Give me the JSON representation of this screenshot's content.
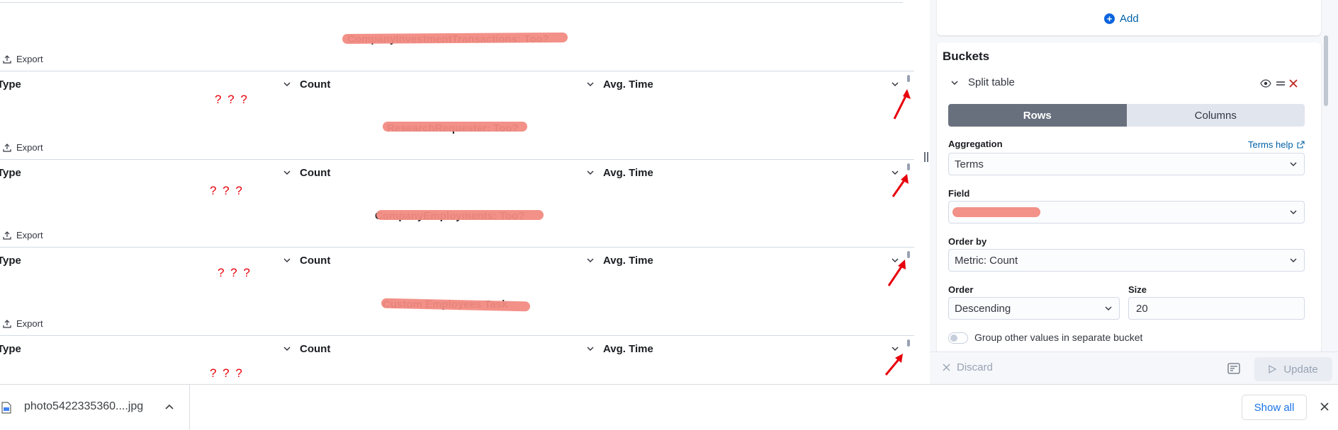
{
  "viz": {
    "tables": [
      {
        "title": "CompanyInvestmentTransactions: Too?",
        "export_label": "Export",
        "columns": [
          "Type",
          "Count",
          "Avg. Time"
        ],
        "cell": "? ? ?"
      },
      {
        "title": "ResearchRequester: Too?",
        "export_label": "Export",
        "columns": [
          "Type",
          "Count",
          "Avg. Time"
        ],
        "cell": "? ? ?"
      },
      {
        "title": "CompanyEmployments: Too?",
        "export_label": "Export",
        "columns": [
          "Type",
          "Count",
          "Avg. Time"
        ],
        "cell": "? ? ?"
      },
      {
        "title": "Custom Employees Task",
        "export_label": "Export",
        "columns": [
          "Type",
          "Count",
          "Avg. Time"
        ],
        "cell": "? ? ?"
      }
    ],
    "redaction_color": "#f28b82",
    "annotation_color": "#e7000b"
  },
  "panel": {
    "add_label": "Add",
    "buckets_title": "Buckets",
    "bucket": {
      "title": "Split table",
      "seg_rows": "Rows",
      "seg_columns": "Columns",
      "aggregation_label": "Aggregation",
      "terms_help": "Terms help",
      "aggregation_value": "Terms",
      "field_label": "Field",
      "field_value": "",
      "order_by_label": "Order by",
      "order_by_value": "Metric: Count",
      "order_label": "Order",
      "order_value": "Descending",
      "size_label": "Size",
      "size_value": "20",
      "group_other_label": "Group other values in separate bucket"
    },
    "discard_label": "Discard",
    "update_label": "Update",
    "accent_color": "#0b64dd"
  },
  "downloads": {
    "file_name": "photo5422335360....jpg",
    "show_all_label": "Show all"
  }
}
